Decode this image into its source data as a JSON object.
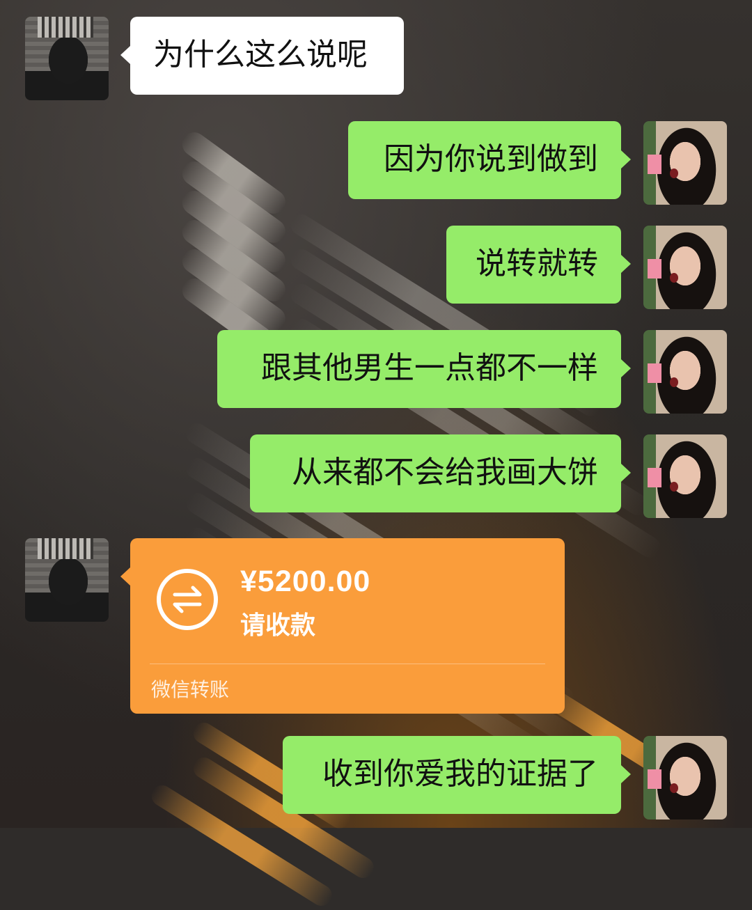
{
  "messages": [
    {
      "side": "left",
      "text": "为什么这么说呢"
    },
    {
      "side": "right",
      "text": "因为你说到做到"
    },
    {
      "side": "right",
      "text": "说转就转"
    },
    {
      "side": "right",
      "text": "跟其他男生一点都不一样"
    },
    {
      "side": "right",
      "text": "从来都不会给我画大饼"
    },
    {
      "side": "right",
      "text": "收到你爱我的证据了"
    }
  ],
  "transfer": {
    "amount": "¥5200.00",
    "status": "请收款",
    "footer": "微信转账",
    "icon": "transfer-arrows-icon"
  },
  "colors": {
    "incoming_bubble": "#ffffff",
    "outgoing_bubble": "#95ec69",
    "transfer_card": "#fa9d3b"
  }
}
